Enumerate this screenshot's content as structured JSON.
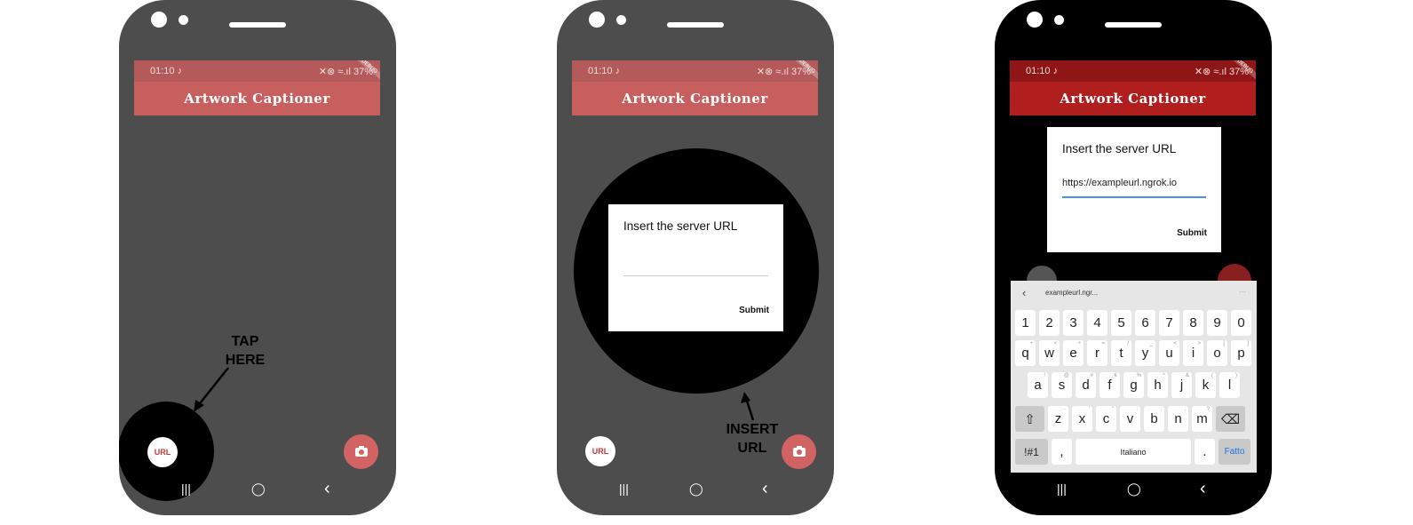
{
  "app": {
    "title": "Artwork Captioner",
    "status_time": "01:10",
    "status_note": "♪",
    "status_right": "✕⊗ ≈.ıl 37%",
    "debug_banner": "DEBUG"
  },
  "nav": {
    "recents": "|||",
    "home": "◯",
    "back": "‹"
  },
  "fab": {
    "url_label": "URL",
    "camera_icon": "camera-icon"
  },
  "panel1": {
    "callout": [
      "TAP",
      "HERE"
    ]
  },
  "panel2": {
    "dialog_title": "Insert the server URL",
    "submit_label": "Submit",
    "callout": [
      "INSERT",
      "URL"
    ]
  },
  "panel3": {
    "dialog_title": "Insert the server URL",
    "url_value": "https://exampleurl.ngrok.io",
    "submit_label": "Submit",
    "suggestion": "exampleurl.ngr...",
    "more": "···"
  },
  "keyboard": {
    "numbers": [
      "1",
      "2",
      "3",
      "4",
      "5",
      "6",
      "7",
      "8",
      "9",
      "0"
    ],
    "row1": [
      {
        "k": "q",
        "s": "+"
      },
      {
        "k": "w",
        "s": "×"
      },
      {
        "k": "e",
        "s": "÷"
      },
      {
        "k": "r",
        "s": "="
      },
      {
        "k": "t",
        "s": "/"
      },
      {
        "k": "y",
        "s": "_"
      },
      {
        "k": "u",
        "s": "<"
      },
      {
        "k": "i",
        "s": ">"
      },
      {
        "k": "o",
        "s": "["
      },
      {
        "k": "p",
        "s": "]"
      }
    ],
    "row2": [
      {
        "k": "a",
        "s": "!"
      },
      {
        "k": "s",
        "s": "@"
      },
      {
        "k": "d",
        "s": "#"
      },
      {
        "k": "f",
        "s": "€"
      },
      {
        "k": "g",
        "s": "%"
      },
      {
        "k": "h",
        "s": "^"
      },
      {
        "k": "j",
        "s": "&"
      },
      {
        "k": "k",
        "s": "("
      },
      {
        "k": "l",
        "s": ")"
      }
    ],
    "row3": [
      {
        "k": "z",
        "s": "-"
      },
      {
        "k": "x",
        "s": "'"
      },
      {
        "k": "c",
        "s": "\""
      },
      {
        "k": "v",
        "s": ":"
      },
      {
        "k": "b",
        "s": ";"
      },
      {
        "k": "n",
        "s": ","
      },
      {
        "k": "m",
        "s": "?"
      }
    ],
    "shift": "⇧",
    "backspace": "⌫",
    "symbols": "!#1",
    "comma": ",",
    "space": "Italiano",
    "period": ".",
    "done": "Fatto"
  },
  "colors": {
    "accent_muted": "#c85f5f",
    "accent_dark": "#b01e1e",
    "done_blue": "#1a73e8"
  }
}
